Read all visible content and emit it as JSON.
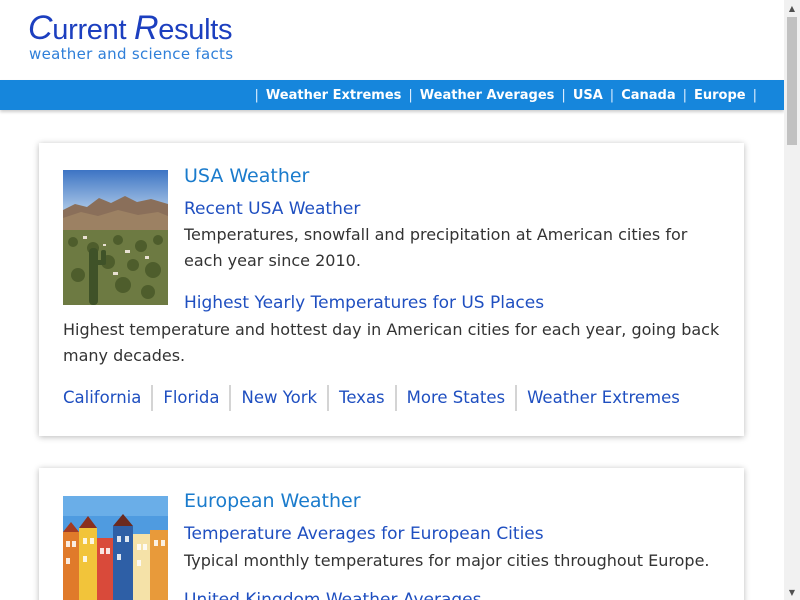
{
  "header": {
    "logo_first_initial": "C",
    "logo_first_rest": "urrent ",
    "logo_second_initial": "R",
    "logo_second_rest": "esults",
    "tagline": "weather and science facts"
  },
  "nav": {
    "separator": "|",
    "items": [
      {
        "label": "Weather Extremes"
      },
      {
        "label": "Weather Averages"
      },
      {
        "label": "USA"
      },
      {
        "label": "Canada"
      },
      {
        "label": "Europe"
      }
    ]
  },
  "cards": [
    {
      "title": "USA Weather",
      "image_icon": "desert-landscape-photo",
      "sections": [
        {
          "link": "Recent USA Weather",
          "description": "Temperatures, snowfall and precipitation at American cities for each year since 2010."
        },
        {
          "link": "Highest Yearly Temperatures for US Places",
          "description": "Highest temperature and hottest day in American cities for each year, going back many decades."
        }
      ],
      "links": [
        "California",
        "Florida",
        "New York",
        "Texas",
        "More States",
        "Weather Extremes"
      ]
    },
    {
      "title": "European Weather",
      "image_icon": "colorful-harbor-houses-photo",
      "sections": [
        {
          "link": "Temperature Averages for European Cities",
          "description": "Typical monthly temperatures for major cities throughout Europe."
        },
        {
          "link": "United Kingdom Weather Averages",
          "description": ""
        }
      ]
    }
  ],
  "scrollbar": {
    "up_icon": "▲",
    "down_icon": "▼"
  },
  "colors": {
    "nav_bg": "#1686dc",
    "logo": "#1c3fbf",
    "title": "#1a7bcc",
    "link": "#1f4fc0"
  }
}
